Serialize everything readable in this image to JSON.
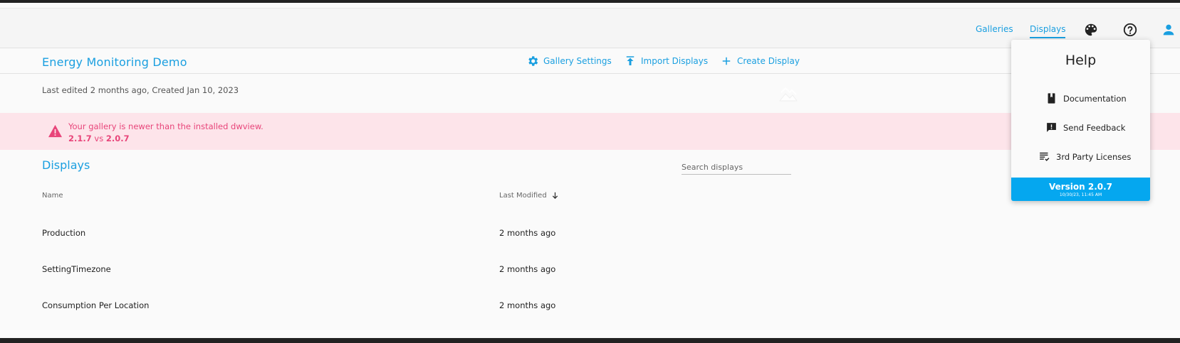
{
  "nav": {
    "galleries": "Galleries",
    "displays": "Displays"
  },
  "icons": {
    "palette": "palette-icon",
    "help": "help-circle-icon",
    "user": "user-icon",
    "settings": "gear-icon",
    "import": "upload-icon",
    "create": "plus-icon",
    "warning": "warning-triangle-icon",
    "sort": "arrow-down-icon",
    "documentation": "book-icon",
    "feedback": "feedback-icon",
    "licenses": "checklist-icon"
  },
  "colors": {
    "accent": "#1a9fe0",
    "warning_text": "#e8457a",
    "warning_bg": "#fde4ea",
    "version_bar": "#05a7ef"
  },
  "gallery": {
    "title": "Energy Monitoring Demo",
    "meta": "Last edited 2 months ago, Created Jan 10, 2023"
  },
  "actions": {
    "settings": "Gallery Settings",
    "import": "Import Displays",
    "create": "Create Display"
  },
  "warning": {
    "message": "Your gallery is newer than the installed dwview.",
    "gallery_version": "2.1.7",
    "vs": "vs",
    "installed_version": "2.0.7"
  },
  "displays": {
    "heading": "Displays",
    "search_placeholder": "Search displays",
    "columns": {
      "name": "Name",
      "last_modified": "Last Modified"
    },
    "rows": [
      {
        "name": "Production",
        "modified": "2 months ago"
      },
      {
        "name": "SettingTimezone",
        "modified": "2 months ago"
      },
      {
        "name": "Consumption Per Location",
        "modified": "2 months ago"
      }
    ]
  },
  "help_menu": {
    "title": "Help",
    "items": [
      "Documentation",
      "Send Feedback",
      "3rd Party Licenses"
    ],
    "version": "Version 2.0.7",
    "version_date": "10/30/23, 11:45 AM"
  }
}
